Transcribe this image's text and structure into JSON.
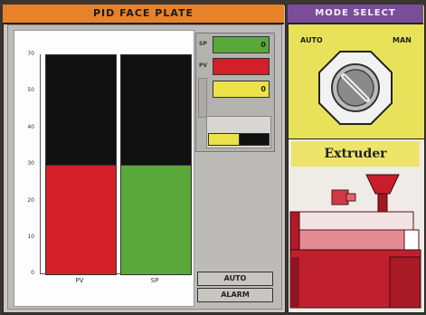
{
  "pid": {
    "title": "PID FACE PLATE",
    "y_ticks": [
      "70",
      "50",
      "40",
      "30",
      "20",
      "10",
      "0"
    ],
    "bars": [
      {
        "label": "PV"
      },
      {
        "label": "SP"
      }
    ],
    "sp_label": "SP",
    "sp_value": "0",
    "pv_label": "PV",
    "output_value": "0",
    "auto_button": "AUTO",
    "alarm_button": "ALARM"
  },
  "mode_select": {
    "title": "MODE SELECT",
    "auto_label": "AUTO",
    "man_label": "MAN"
  },
  "extruder": {
    "title": "Extruder"
  },
  "colors": {
    "pv": "#d41f2a",
    "sp": "#5aa83a",
    "header_orange": "#e8822a",
    "header_purple": "#7a4d98",
    "panel_yellow": "#e8e25a"
  }
}
